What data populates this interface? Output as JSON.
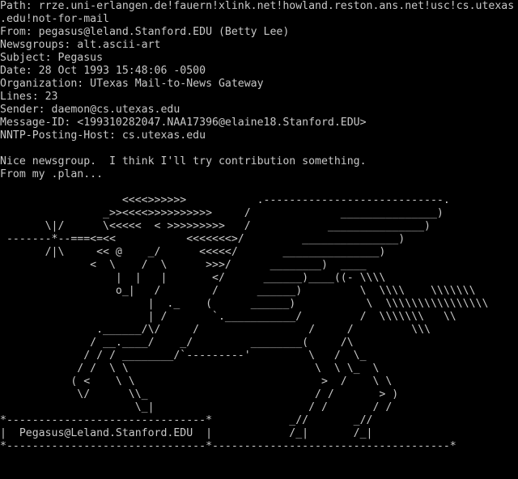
{
  "terminal": {
    "background": "#000000",
    "foreground": "#c8c8c8"
  },
  "headers": {
    "path_1": "Path: rrze.uni-erlangen.de!fauern!xlink.net!howland.reston.ans.net!usc!cs.utexas",
    "path_2": ".edu!not-for-mail",
    "from": "From: pegasus@leland.Stanford.EDU (Betty Lee)",
    "newsgroups": "Newsgroups: alt.ascii-art",
    "subject": "Subject: Pegasus",
    "date": "Date: 28 Oct 1993 15:48:06 -0500",
    "organization": "Organization: UTexas Mail-to-News Gateway",
    "lines": "Lines: 23",
    "sender": "Sender: daemon@cs.utexas.edu",
    "message_id": "Message-ID: <199310282047.NAA17396@elaine18.Stanford.EDU>",
    "nntp_posting_host": "NNTP-Posting-Host: cs.utexas.edu"
  },
  "body_text": {
    "line_1": "Nice newsgroup.  I think I'll try contribution something.",
    "line_2": "From my .plan..."
  },
  "ascii_art": {
    "rows": [
      "                   <<<<>>>>>>           .----------------------------.",
      "                _>><<<<>>>>>>>>>>     /              _______________)",
      "       \\|/      \\<<<<<  < >>>>>>>>>   /            _______________)",
      " -------*--===<=<<           <<<<<<<>/         _______________)",
      "       /|\\     << @    _/      <<<<</       _______________)",
      "              <  \\    /  \\      >>>/      ________)  ____",
      "                  |  |   |       </      ______)____((- \\\\\\\\",
      "                  o_|   /        /      ______)         \\  \\\\\\\\    \\\\\\\\\\\\\\",
      "                       |  ._    (      ______)           \\  \\\\\\\\\\\\\\\\\\\\\\\\\\\\\\\\",
      "                       | /       `.___________/         /  \\\\\\\\\\\\\\   \\\\",
      "               .______/\\/     /                 /     /         \\\\\\",
      "              / __.____/    _/         ________(     /\\",
      "             / / / ________/`---------'         \\   /  \\_",
      "            / /  \\ \\                             \\  \\ \\_  \\",
      "           ( <    \\ \\                             >  /    \\ \\",
      "            \\/      \\\\_                          / /       > )",
      "                     \\_|                        / /       / /",
      "*-------------------------------*            _//       _//",
      "|  Pegasus@Leland.Stanford.EDU  |            /_|       /_|",
      "*-------------------------------*-------------------------------------*"
    ]
  }
}
